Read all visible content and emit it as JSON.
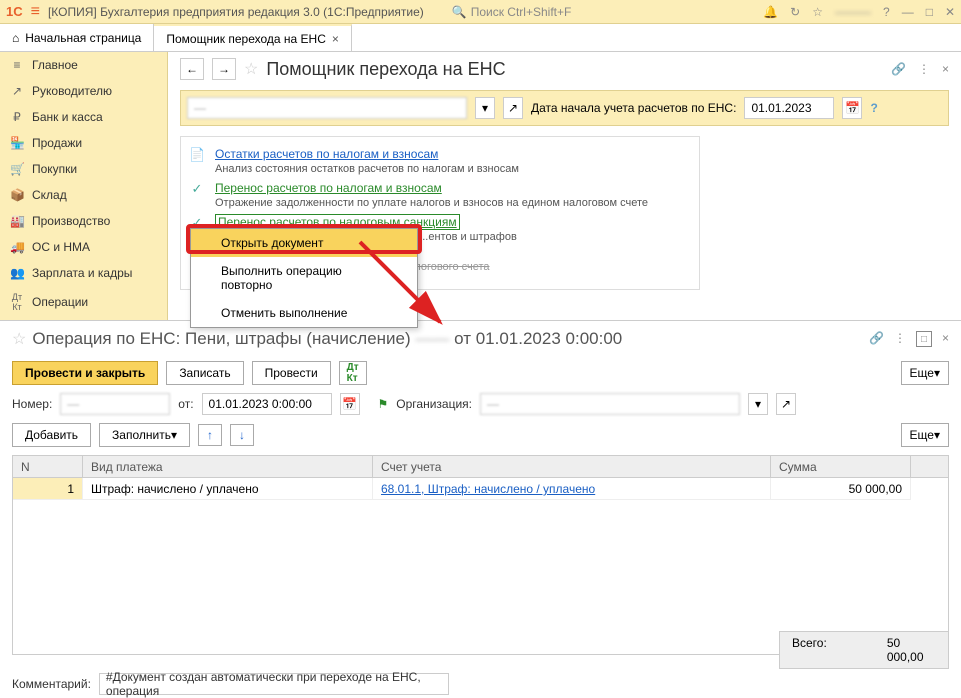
{
  "topbar": {
    "title": "[КОПИЯ] Бухгалтерия предприятия        редакция 3.0  (1С:Предприятие)",
    "search_placeholder": "Поиск Ctrl+Shift+F"
  },
  "tabs": {
    "home": "Начальная страница",
    "assistant": "Помощник перехода на ЕНС"
  },
  "sidebar": [
    "Главное",
    "Руководителю",
    "Банк и касса",
    "Продажи",
    "Покупки",
    "Склад",
    "Производство",
    "ОС и НМА",
    "Зарплата и кадры",
    "Операции"
  ],
  "assistant": {
    "title": "Помощник перехода на ЕНС",
    "date_label": "Дата начала учета расчетов по ЕНС:",
    "date_value": "01.01.2023",
    "steps": [
      {
        "icon": "doc",
        "link": "Остатки расчетов по налогам и взносам",
        "cls": "",
        "desc": "Анализ состояния остатков расчетов по налогам и взносам"
      },
      {
        "icon": "✓",
        "link": "Перенос расчетов по налогам и взносам",
        "cls": "green",
        "desc": "Отражение задолженности по уплате налогов и взносов на едином налоговом счете"
      },
      {
        "icon": "✓",
        "link": "Перенос расчетов по налоговым санкциям",
        "cls": "green boxed",
        "desc": "Отражение задолженности по уплате ......ентов и штрафов"
      },
      {
        "icon": "➜",
        "link": "",
        "cls": "",
        "desc": "......положительного сальдо единого налогового счета"
      }
    ]
  },
  "ctx": {
    "open": "Открыть документ",
    "redo": "Выполнить операцию повторно",
    "cancel": "Отменить выполнение"
  },
  "doc": {
    "title_prefix": "Операция по ЕНС: Пени, штрафы (начисление)",
    "title_suffix": "от 01.01.2023 0:00:00",
    "btn_post_close": "Провести и закрыть",
    "btn_save": "Записать",
    "btn_post": "Провести",
    "btn_more": "Еще",
    "number_label": "Номер:",
    "date_label": "от:",
    "date_value": "01.01.2023  0:00:00",
    "org_label": "Организация:",
    "btn_add": "Добавить",
    "btn_fill": "Заполнить",
    "cols": {
      "n": "N",
      "type": "Вид платежа",
      "acct": "Счет учета",
      "sum": "Сумма"
    },
    "row": {
      "n": "1",
      "type": "Штраф: начислено / уплачено",
      "acct": "68.01.1, Штраф: начислено / уплачено",
      "sum": "50 000,00"
    },
    "total_label": "Всего:",
    "total_value": "50 000,00",
    "comment_label": "Комментарий:",
    "comment_value": "#Документ создан автоматически при переходе на ЕНС, операция"
  }
}
